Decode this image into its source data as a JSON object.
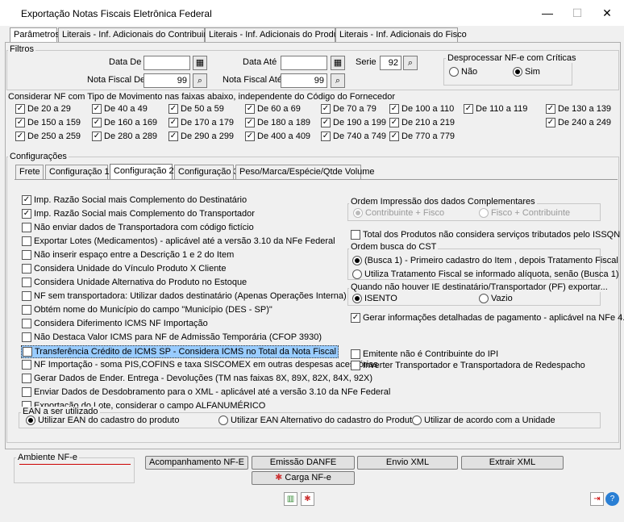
{
  "window": {
    "title": "Exportação Notas Fiscais Eletrônica Federal",
    "minimize": "—",
    "maximize": "☐",
    "close": "✕"
  },
  "tabs": [
    {
      "label": "Parâmetros"
    },
    {
      "label": "Literais - Inf. Adicionais do Contribuinte"
    },
    {
      "label": "Literais - Inf. Adicionais do Produto"
    },
    {
      "label": "Literais - Inf. Adicionais do Fisco"
    }
  ],
  "filtros": {
    "legend": "Filtros",
    "data_de_label": "Data De",
    "data_de_value": "",
    "data_ate_label": "Data Até",
    "data_ate_value": "",
    "nf_de_label": "Nota Fiscal De",
    "nf_de_value": "99",
    "nf_ate_label": "Nota Fiscal Até",
    "nf_ate_value": "99",
    "serie_label": "Serie",
    "serie_value": "92",
    "desprocessar": {
      "legend": "Desprocessar NF-e com Críticas",
      "nao": "Não",
      "sim": "Sim",
      "selected": "Sim"
    }
  },
  "faixas": {
    "header": "Considerar NF com Tipo de Movimento nas faixas abaixo, independente do Código do Fornecedor",
    "items": [
      {
        "label": "De 20 a 29"
      },
      {
        "label": "De 40 a 49"
      },
      {
        "label": "De 50 a 59"
      },
      {
        "label": "De 60 a 69"
      },
      {
        "label": "De 70 a 79"
      },
      {
        "label": "De 100 a 110"
      },
      {
        "label": "De 110 a 119"
      },
      {
        "label": "De 130 a 139"
      },
      {
        "label": "De 150 a 159"
      },
      {
        "label": "De 160 a 169"
      },
      {
        "label": "De 170 a 179"
      },
      {
        "label": "De 180 a 189"
      },
      {
        "label": "De 190 a 199"
      },
      {
        "label": "De 210 a 219"
      },
      {
        "label": "De 240 a 249"
      },
      {
        "label": "De 250 a 259"
      },
      {
        "label": "De 280 a 289"
      },
      {
        "label": "De 290 a 299"
      },
      {
        "label": "De 400 a 409"
      },
      {
        "label": "De 740 a 749"
      },
      {
        "label": "De 770 a 779"
      }
    ]
  },
  "configuracoes": {
    "legend": "Configurações",
    "subtabs": [
      {
        "label": "Frete"
      },
      {
        "label": "Configuração 1"
      },
      {
        "label": "Configuração 2"
      },
      {
        "label": "Configuração 3"
      },
      {
        "label": "Peso/Marca/Espécie/Qtde Volume"
      }
    ],
    "left_options": [
      {
        "label": "Imp. Razão Social mais Complemento do Destinatário",
        "checked": true
      },
      {
        "label": "Imp. Razão Social mais Complemento do Transportador",
        "checked": true
      },
      {
        "label": "Não enviar dados de Transportadora com código fictício",
        "checked": false
      },
      {
        "label": "Exportar Lotes (Medicamentos) - aplicável até a versão 3.10 da NFe Federal",
        "checked": false
      },
      {
        "label": "Não inserir espaço entre a Descrição 1 e 2 do Item",
        "checked": false
      },
      {
        "label": "Considera Unidade do Vínculo Produto X Cliente",
        "checked": false
      },
      {
        "label": "Considera Unidade Alternativa do Produto no Estoque",
        "checked": false
      },
      {
        "label": "NF sem transportadora: Utilizar dados destinatário (Apenas Operações Interna)",
        "checked": false
      },
      {
        "label": "Obtém nome do Município do campo \"Município (DES - SP)\"",
        "checked": false
      },
      {
        "label": "Considera Diferimento ICMS NF Importação",
        "checked": false
      },
      {
        "label": "Não Destaca Valor ICMS para NF de Admissão Temporária (CFOP 3930)",
        "checked": false
      },
      {
        "label": "Transferência Crédito de ICMS SP - Considera ICMS no Total da Nota Fiscal",
        "checked": false
      },
      {
        "label": "NF Importação - soma PIS,COFINS e taxa SISCOMEX em outras despesas acessórias",
        "checked": false
      },
      {
        "label": "Gerar Dados de Ender. Entrega - Devoluções (TM nas faixas 8X, 89X, 82X, 84X, 92X)",
        "checked": false
      },
      {
        "label": "Enviar Dados de Desdobramento para o XML - aplicável até a versão 3.10 da NFe Federal",
        "checked": false
      },
      {
        "label": "Exportação do Lote, considerar o campo ALFANUMÉRICO",
        "checked": false
      }
    ],
    "ordem_impressao": {
      "legend": "Ordem Impressão dos dados Complementares",
      "opt1": "Contribuinte + Fisco",
      "opt2": "Fisco + Contribuinte"
    },
    "total_produtos": "Total dos Produtos não considera serviços tributados pelo ISSQN",
    "ordem_cst": {
      "legend": "Ordem busca do CST",
      "opt1": "(Busca 1) - Primeiro cadastro do Item , depois Tratamento Fiscal",
      "opt2": "Utiliza Tratamento Fiscal se informado alíquota, senão (Busca 1)"
    },
    "ie_group": {
      "legend": "Quando não houver IE destinatário/Transportador (PF) exportar...",
      "opt1": "ISENTO",
      "opt2": "Vazio"
    },
    "gerar_pagamento": "Gerar informações detalhadas de pagamento - aplicável na NFe 4.00",
    "emitente": "Emitente não é Contribuinte do IPI",
    "inverter": "Inverter Transportador e Transportadora de Redespacho",
    "ean": {
      "legend": "EAN a ser utilizado",
      "opt1": "Utilizar EAN do cadastro do produto",
      "opt2": "Utilizar EAN Alternativo do cadastro do Produto",
      "opt3": "Utilizar de acordo com a Unidade"
    }
  },
  "bottom": {
    "ambiente_legend": "Ambiente NF-e",
    "acompanhamento": "Acompanhamento NF-E",
    "emissao": "Emissão DANFE",
    "envio": "Envio XML",
    "extrair": "Extrair XML",
    "carga": "Carga NF-e"
  }
}
